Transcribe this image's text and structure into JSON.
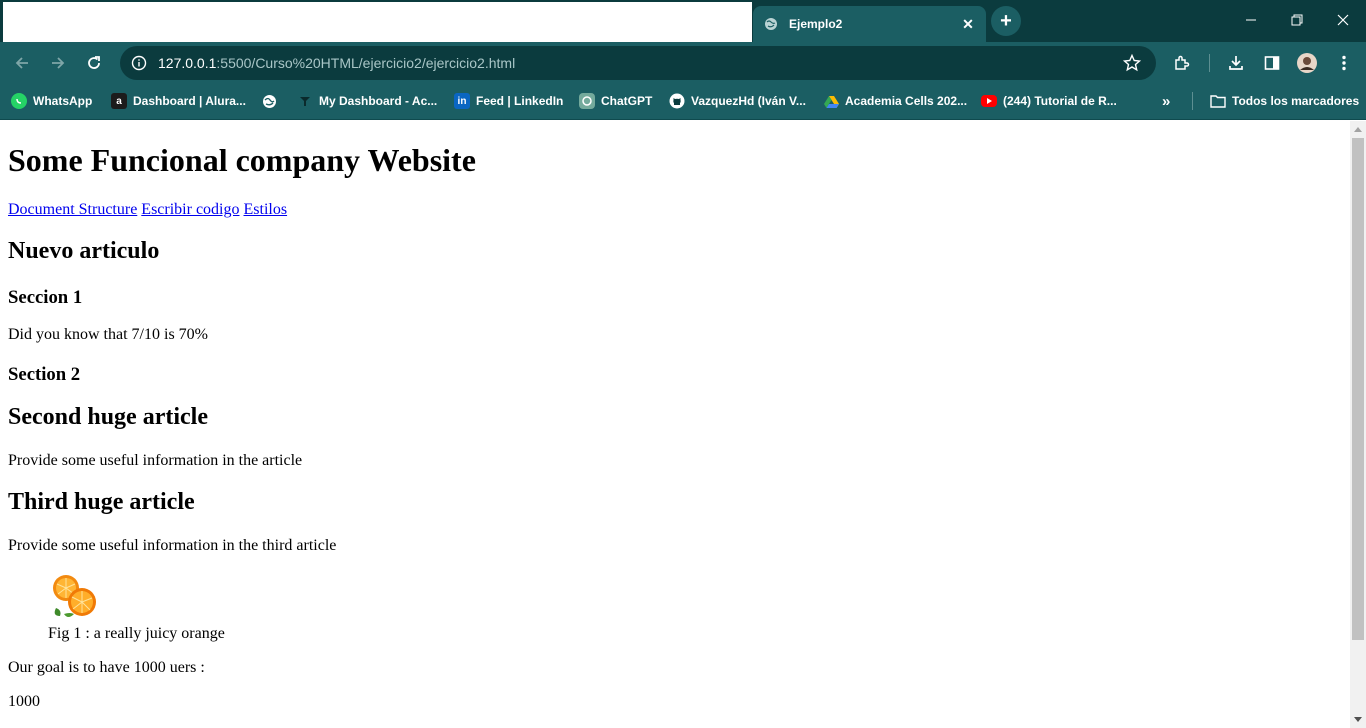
{
  "browser": {
    "tab": {
      "title": "Ejemplo2",
      "close": "✕"
    },
    "new_tab": "+",
    "url_host": "127.0.0.1",
    "url_rest": ":5500/Curso%20HTML/ejercicio2/ejercicio2.html",
    "bookmarks": [
      {
        "label": "WhatsApp",
        "icon": "whatsapp-icon",
        "color": "#25D366"
      },
      {
        "label": "Dashboard | Alura...",
        "icon": "alura-icon",
        "color": "#1c1c1c"
      },
      {
        "label": "",
        "icon": "globe-icon",
        "color": "#1b5e63"
      },
      {
        "label": "My Dashboard - Ac...",
        "icon": "dashboard-icon",
        "color": "#1b5e63"
      },
      {
        "label": "Feed | LinkedIn",
        "icon": "linkedin-icon",
        "color": "#0a66c2"
      },
      {
        "label": "ChatGPT",
        "icon": "chatgpt-icon",
        "color": "#74aa9c"
      },
      {
        "label": "VazquezHd (Iván V...",
        "icon": "github-icon",
        "color": "#1b5e63"
      },
      {
        "label": "Academia Cells 202...",
        "icon": "google-drive-icon",
        "color": "#1b5e63"
      },
      {
        "label": "(244) Tutorial de R...",
        "icon": "youtube-icon",
        "color": "#ff0000"
      }
    ],
    "overflow": "»",
    "all_bookmarks": "Todos los marcadores"
  },
  "page": {
    "title": "Some Funcional company Website",
    "nav": [
      "Document Structure",
      "Escribir codigo",
      "Estilos"
    ],
    "article1_heading": "Nuevo articulo",
    "section1_heading": "Seccion 1",
    "section1_text": "Did you know that 7/10 is 70%",
    "section2_heading": "Section 2",
    "article2_heading": "Second huge article",
    "article2_text": "Provide some useful information in the article",
    "article3_heading": "Third huge article",
    "article3_text": "Provide some useful information in the third article",
    "figure_caption": "Fig 1 : a really juicy orange",
    "goal_text": "Our goal is to have 1000 uers :",
    "goal_value": "1000"
  }
}
